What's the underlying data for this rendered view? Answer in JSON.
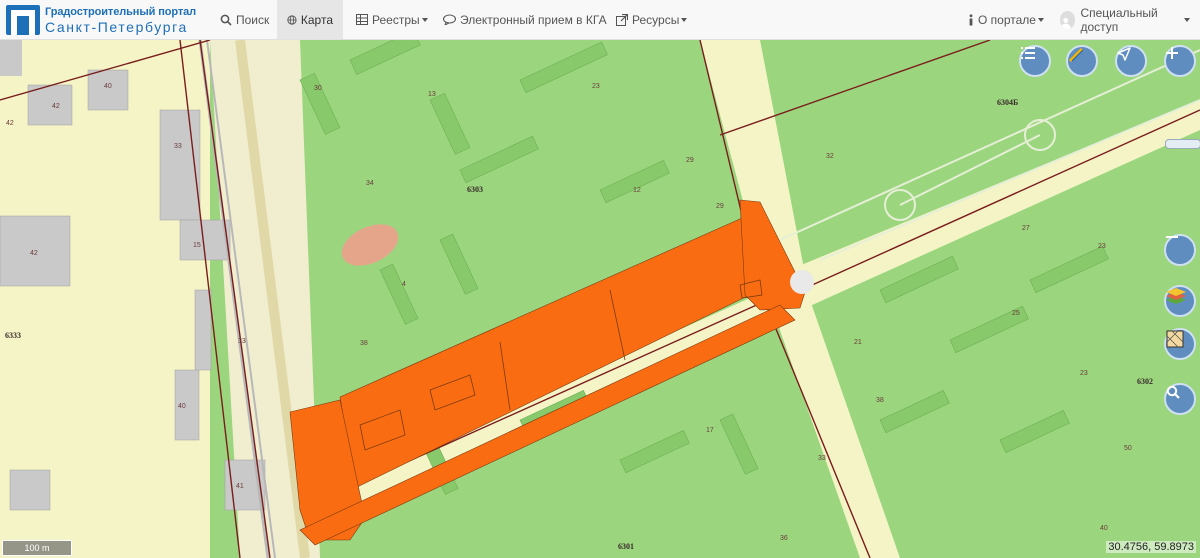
{
  "brand": {
    "line1": "Градостроительный портал",
    "line2": "Санкт-Петербурга"
  },
  "nav": {
    "search": "Поиск",
    "map": "Карта",
    "registries": "Реестры",
    "reception": "Электронный прием в КГА",
    "resources": "Ресурсы",
    "about": "О портале",
    "special": "Специальный доступ"
  },
  "map": {
    "scale": "100 m",
    "coords": "30.4756, 59.8973",
    "block_labels": [
      "6303",
      "6304Б",
      "6333",
      "6302",
      "6301"
    ],
    "colors": {
      "highlight": "#fa6c12",
      "green": "#9bd67f",
      "road": "#f4f4c6"
    }
  },
  "icons": {
    "search": "search-icon",
    "globe": "globe-icon",
    "registry": "table-icon",
    "chat": "chat-icon",
    "external": "external-link-icon",
    "about": "info-icon",
    "user": "user-icon"
  }
}
